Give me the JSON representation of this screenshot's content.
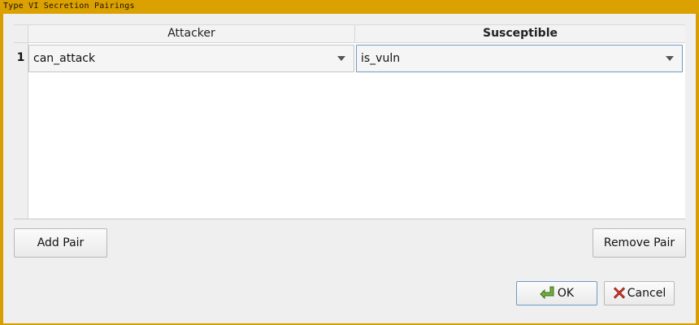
{
  "window": {
    "title": "Type VI Secretion Pairings"
  },
  "table": {
    "headers": [
      "Attacker",
      "Susceptible"
    ],
    "rows": [
      {
        "number": "1",
        "attacker": "can_attack",
        "susceptible": "is_vuln"
      }
    ]
  },
  "buttons": {
    "add_pair": "Add Pair",
    "remove_pair": "Remove Pair",
    "ok": "OK",
    "cancel": "Cancel"
  },
  "icons": {
    "ok": "green-check-arrow-icon",
    "cancel": "red-x-icon"
  },
  "colors": {
    "title_bar": "#dba100",
    "focus_border": "#6f9ac6"
  }
}
